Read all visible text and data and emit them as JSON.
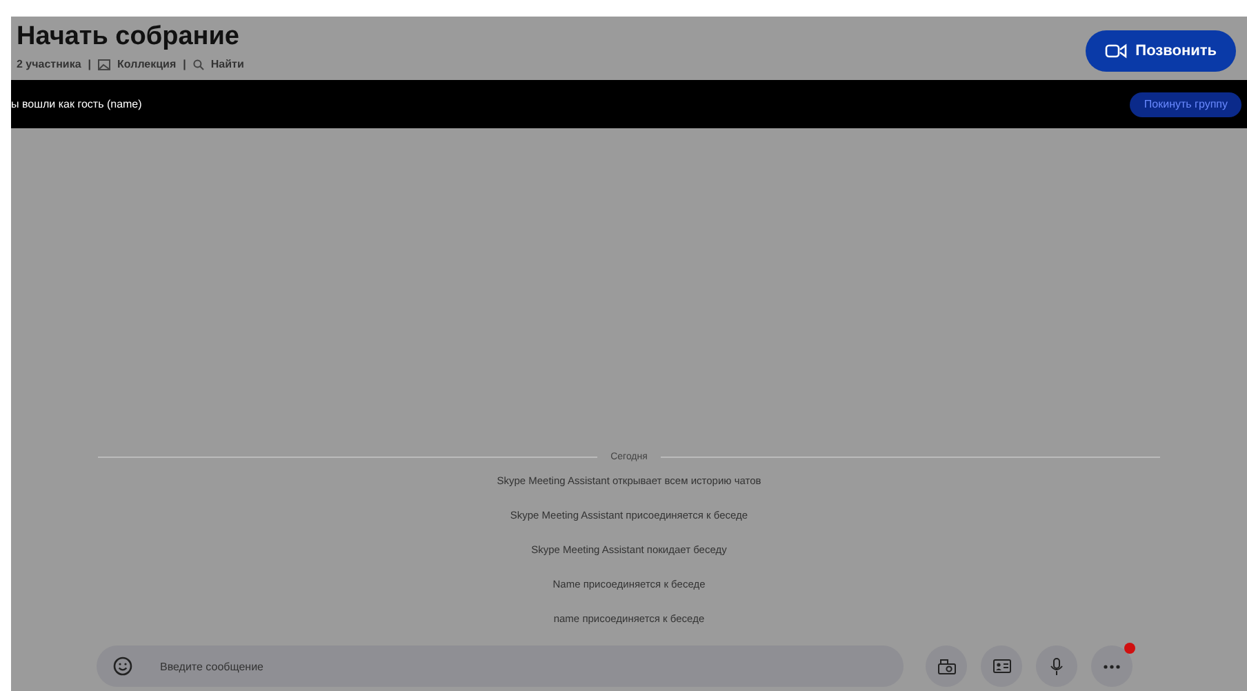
{
  "header": {
    "title": "Начать собрание",
    "participants": "2 участника",
    "separator_1": "|",
    "gallery": "Коллекция",
    "separator_2": "|",
    "search": "Найти",
    "call_button": "Позвонить"
  },
  "guest_banner": {
    "text": "ы вошли как гость (name)",
    "leave_button": "Покинуть группу"
  },
  "chat": {
    "date_divider": "Сегодня",
    "messages": [
      {
        "text": "Skype Meeting Assistant открывает всем историю чатов"
      },
      {
        "text": "Skype Meeting Assistant присоединяется к беседе"
      },
      {
        "text": "Skype Meeting Assistant покидает беседу"
      },
      {
        "text": "Name присоединяется к беседе"
      },
      {
        "text": "name присоединяется к беседе"
      }
    ]
  },
  "composer": {
    "placeholder": "Введите сообщение",
    "more_notification": true
  }
}
